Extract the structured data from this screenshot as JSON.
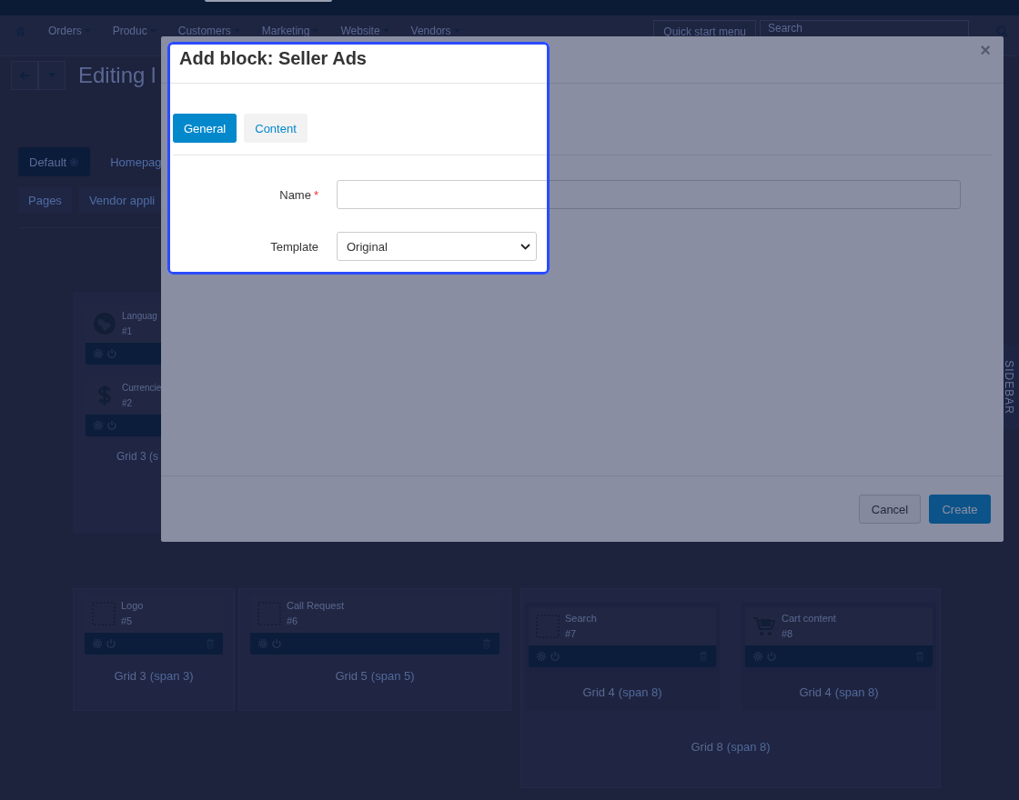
{
  "top_nav": {
    "items": [
      {
        "label": "Orders"
      },
      {
        "label": "Produc"
      },
      {
        "label": "Customers"
      },
      {
        "label": "Marketing"
      },
      {
        "label": "Website"
      },
      {
        "label": "Vendors"
      }
    ],
    "quick_menu": "Quick start menu",
    "search_placeholder": "Search"
  },
  "toolbar": {
    "title": "Editing l"
  },
  "layout_tabs": [
    {
      "label": "Default",
      "selected": true
    },
    {
      "label": "Homepag",
      "selected": false
    }
  ],
  "page_tabs": [
    {
      "label": "Pages"
    },
    {
      "label": "Vendor appli"
    }
  ],
  "left_grid": {
    "blocks": [
      {
        "name": "Languag",
        "number": "#1",
        "kind": "globe"
      },
      {
        "name": "Currencie",
        "number": "#2",
        "kind": "dollar"
      }
    ],
    "title": "Grid 3 (s"
  },
  "grids": [
    {
      "title": "Grid 3",
      "span": "(span 3)",
      "blocks": [
        {
          "name": "Logo",
          "number": "#5",
          "kind": "placeholder",
          "deletable": true
        }
      ]
    },
    {
      "title": "Grid 5",
      "span": "(span 5)",
      "blocks": [
        {
          "name": "Call Request",
          "number": "#6",
          "kind": "placeholder",
          "deletable": true
        }
      ]
    },
    {
      "title": "Grid 8",
      "span": "(span 8)",
      "children": [
        {
          "title": "Grid 4",
          "span": "(span 8)",
          "blocks": [
            {
              "name": "Search",
              "number": "#7",
              "kind": "placeholder",
              "deletable": true
            }
          ]
        },
        {
          "title": "Grid 4",
          "span": "(span 8)",
          "blocks": [
            {
              "name": "Cart content",
              "number": "#8",
              "kind": "cart",
              "deletable": true
            }
          ]
        }
      ]
    }
  ],
  "sidebar_tab": "SIDEBAR",
  "modal": {
    "title": "Add block: Seller Ads",
    "close": "×",
    "required_mark": "*",
    "tabs": [
      {
        "label": "General",
        "selected": true
      },
      {
        "label": "Content",
        "selected": false
      }
    ],
    "fields": [
      {
        "label": "Name",
        "required": true,
        "kind": "text"
      },
      {
        "label": "Template",
        "required": false,
        "kind": "select",
        "value": "Original"
      }
    ],
    "buttons": [
      {
        "label": "Cancel",
        "kind": "secondary"
      },
      {
        "label": "Create",
        "kind": "primary"
      }
    ]
  }
}
